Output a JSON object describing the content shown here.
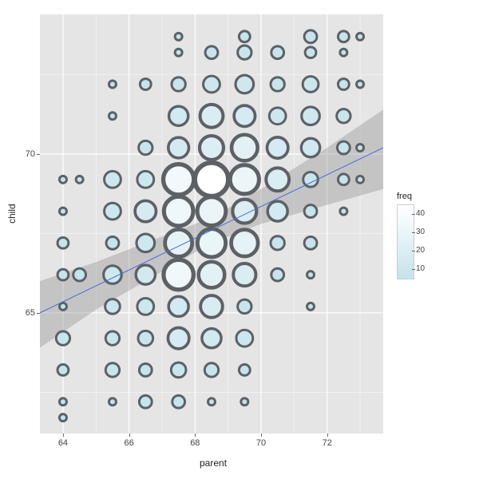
{
  "chart_data": {
    "type": "scatter",
    "xlabel": "parent",
    "ylabel": "child",
    "xlim": [
      63.3,
      73.7
    ],
    "ylim": [
      61.2,
      74.4
    ],
    "x_ticks_major": [
      64,
      66,
      68,
      70,
      72
    ],
    "y_ticks_major": [
      65,
      70
    ],
    "x_ticks_minor": [
      65,
      67,
      69,
      71,
      73
    ],
    "freq_scale": {
      "min": 1,
      "max": 48
    },
    "regression": {
      "x_from": 63.3,
      "y_from": 65.0,
      "x_to": 73.7,
      "y_to": 70.2
    },
    "confidence_band": [
      {
        "x": 63.3,
        "y_low": 63.9,
        "y_high": 66.0
      },
      {
        "x": 65.0,
        "y_low": 65.1,
        "y_high": 66.6
      },
      {
        "x": 67.0,
        "y_low": 66.3,
        "y_high": 67.4
      },
      {
        "x": 68.5,
        "y_low": 67.2,
        "y_high": 68.0
      },
      {
        "x": 70.0,
        "y_low": 67.8,
        "y_high": 68.9
      },
      {
        "x": 72.0,
        "y_low": 68.4,
        "y_high": 70.2
      },
      {
        "x": 73.7,
        "y_low": 68.9,
        "y_high": 71.4
      }
    ],
    "points": [
      {
        "parent": 64.0,
        "child": 61.7,
        "freq": 1
      },
      {
        "parent": 64.0,
        "child": 62.2,
        "freq": 1
      },
      {
        "parent": 64.0,
        "child": 63.2,
        "freq": 2
      },
      {
        "parent": 64.0,
        "child": 64.2,
        "freq": 4
      },
      {
        "parent": 64.0,
        "child": 65.2,
        "freq": 1
      },
      {
        "parent": 64.0,
        "child": 66.2,
        "freq": 2
      },
      {
        "parent": 64.0,
        "child": 67.2,
        "freq": 2
      },
      {
        "parent": 64.0,
        "child": 68.2,
        "freq": 1
      },
      {
        "parent": 64.0,
        "child": 69.2,
        "freq": 1
      },
      {
        "parent": 64.5,
        "child": 66.2,
        "freq": 3
      },
      {
        "parent": 64.5,
        "child": 69.2,
        "freq": 1
      },
      {
        "parent": 65.5,
        "child": 62.2,
        "freq": 1
      },
      {
        "parent": 65.5,
        "child": 63.2,
        "freq": 4
      },
      {
        "parent": 65.5,
        "child": 64.2,
        "freq": 4
      },
      {
        "parent": 65.5,
        "child": 65.2,
        "freq": 5
      },
      {
        "parent": 65.5,
        "child": 66.2,
        "freq": 9
      },
      {
        "parent": 65.5,
        "child": 67.2,
        "freq": 3
      },
      {
        "parent": 65.5,
        "child": 68.2,
        "freq": 7
      },
      {
        "parent": 65.5,
        "child": 69.2,
        "freq": 7
      },
      {
        "parent": 65.5,
        "child": 71.2,
        "freq": 1
      },
      {
        "parent": 65.5,
        "child": 72.2,
        "freq": 1
      },
      {
        "parent": 66.5,
        "child": 62.2,
        "freq": 3
      },
      {
        "parent": 66.5,
        "child": 63.2,
        "freq": 3
      },
      {
        "parent": 66.5,
        "child": 64.2,
        "freq": 5
      },
      {
        "parent": 66.5,
        "child": 65.2,
        "freq": 7
      },
      {
        "parent": 66.5,
        "child": 66.2,
        "freq": 11
      },
      {
        "parent": 66.5,
        "child": 67.2,
        "freq": 9
      },
      {
        "parent": 66.5,
        "child": 68.2,
        "freq": 14
      },
      {
        "parent": 66.5,
        "child": 69.2,
        "freq": 7
      },
      {
        "parent": 66.5,
        "child": 70.2,
        "freq": 4
      },
      {
        "parent": 66.5,
        "child": 72.2,
        "freq": 2
      },
      {
        "parent": 67.5,
        "child": 62.2,
        "freq": 3
      },
      {
        "parent": 67.5,
        "child": 63.2,
        "freq": 5
      },
      {
        "parent": 67.5,
        "child": 64.2,
        "freq": 14
      },
      {
        "parent": 67.5,
        "child": 65.2,
        "freq": 12
      },
      {
        "parent": 67.5,
        "child": 66.2,
        "freq": 36
      },
      {
        "parent": 67.5,
        "child": 67.2,
        "freq": 28
      },
      {
        "parent": 67.5,
        "child": 68.2,
        "freq": 34
      },
      {
        "parent": 67.5,
        "child": 69.2,
        "freq": 38
      },
      {
        "parent": 67.5,
        "child": 70.2,
        "freq": 13
      },
      {
        "parent": 67.5,
        "child": 71.2,
        "freq": 11
      },
      {
        "parent": 67.5,
        "child": 72.2,
        "freq": 4
      },
      {
        "parent": 67.5,
        "child": 73.2,
        "freq": 1
      },
      {
        "parent": 67.5,
        "child": 73.7,
        "freq": 1
      },
      {
        "parent": 68.5,
        "child": 62.2,
        "freq": 1
      },
      {
        "parent": 68.5,
        "child": 63.2,
        "freq": 4
      },
      {
        "parent": 68.5,
        "child": 64.2,
        "freq": 11
      },
      {
        "parent": 68.5,
        "child": 65.2,
        "freq": 16
      },
      {
        "parent": 68.5,
        "child": 66.2,
        "freq": 25
      },
      {
        "parent": 68.5,
        "child": 67.2,
        "freq": 31
      },
      {
        "parent": 68.5,
        "child": 68.2,
        "freq": 32
      },
      {
        "parent": 68.5,
        "child": 69.2,
        "freq": 48
      },
      {
        "parent": 68.5,
        "child": 70.2,
        "freq": 20
      },
      {
        "parent": 68.5,
        "child": 71.2,
        "freq": 18
      },
      {
        "parent": 68.5,
        "child": 72.2,
        "freq": 7
      },
      {
        "parent": 68.5,
        "child": 73.2,
        "freq": 3
      },
      {
        "parent": 69.5,
        "child": 62.2,
        "freq": 1
      },
      {
        "parent": 69.5,
        "child": 63.2,
        "freq": 2
      },
      {
        "parent": 69.5,
        "child": 64.2,
        "freq": 7
      },
      {
        "parent": 69.5,
        "child": 65.2,
        "freq": 4
      },
      {
        "parent": 69.5,
        "child": 66.2,
        "freq": 17
      },
      {
        "parent": 69.5,
        "child": 67.2,
        "freq": 27
      },
      {
        "parent": 69.5,
        "child": 68.2,
        "freq": 20
      },
      {
        "parent": 69.5,
        "child": 69.2,
        "freq": 33
      },
      {
        "parent": 69.5,
        "child": 70.2,
        "freq": 25
      },
      {
        "parent": 69.5,
        "child": 71.2,
        "freq": 14
      },
      {
        "parent": 69.5,
        "child": 72.2,
        "freq": 9
      },
      {
        "parent": 69.5,
        "child": 73.2,
        "freq": 4
      },
      {
        "parent": 69.5,
        "child": 73.7,
        "freq": 2
      },
      {
        "parent": 70.5,
        "child": 66.2,
        "freq": 3
      },
      {
        "parent": 70.5,
        "child": 67.2,
        "freq": 4
      },
      {
        "parent": 70.5,
        "child": 68.2,
        "freq": 12
      },
      {
        "parent": 70.5,
        "child": 69.2,
        "freq": 18
      },
      {
        "parent": 70.5,
        "child": 70.2,
        "freq": 14
      },
      {
        "parent": 70.5,
        "child": 71.2,
        "freq": 7
      },
      {
        "parent": 70.5,
        "child": 72.2,
        "freq": 4
      },
      {
        "parent": 70.5,
        "child": 73.2,
        "freq": 3
      },
      {
        "parent": 71.5,
        "child": 65.2,
        "freq": 1
      },
      {
        "parent": 71.5,
        "child": 66.2,
        "freq": 1
      },
      {
        "parent": 71.5,
        "child": 67.2,
        "freq": 3
      },
      {
        "parent": 71.5,
        "child": 68.2,
        "freq": 3
      },
      {
        "parent": 71.5,
        "child": 69.2,
        "freq": 5
      },
      {
        "parent": 71.5,
        "child": 70.2,
        "freq": 10
      },
      {
        "parent": 71.5,
        "child": 71.2,
        "freq": 9
      },
      {
        "parent": 71.5,
        "child": 72.2,
        "freq": 6
      },
      {
        "parent": 71.5,
        "child": 73.2,
        "freq": 2
      },
      {
        "parent": 71.5,
        "child": 73.7,
        "freq": 3
      },
      {
        "parent": 72.5,
        "child": 68.2,
        "freq": 1
      },
      {
        "parent": 72.5,
        "child": 69.2,
        "freq": 2
      },
      {
        "parent": 72.5,
        "child": 70.2,
        "freq": 3
      },
      {
        "parent": 72.5,
        "child": 71.2,
        "freq": 4
      },
      {
        "parent": 72.5,
        "child": 72.2,
        "freq": 2
      },
      {
        "parent": 72.5,
        "child": 73.2,
        "freq": 1
      },
      {
        "parent": 72.5,
        "child": 73.7,
        "freq": 2
      },
      {
        "parent": 73.0,
        "child": 69.2,
        "freq": 1
      },
      {
        "parent": 73.0,
        "child": 70.2,
        "freq": 1
      },
      {
        "parent": 73.0,
        "child": 72.2,
        "freq": 1
      },
      {
        "parent": 73.0,
        "child": 73.7,
        "freq": 1
      }
    ]
  },
  "legend": {
    "title": "freq",
    "ticks": [
      10,
      20,
      30,
      40
    ]
  }
}
